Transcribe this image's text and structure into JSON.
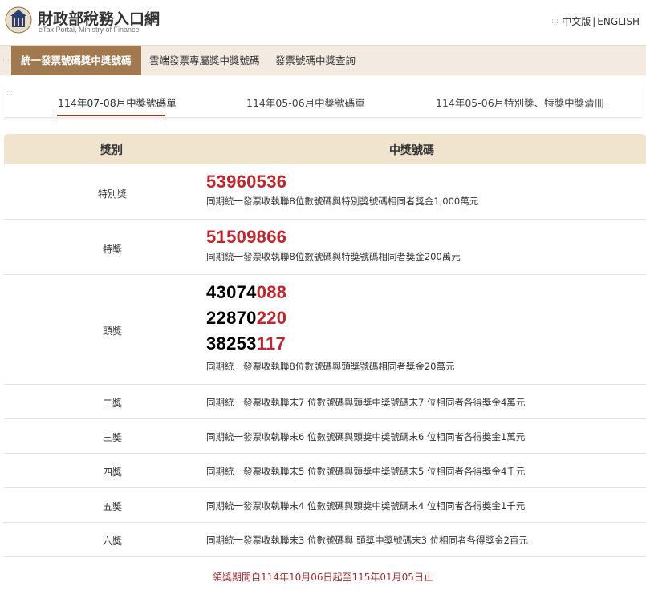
{
  "header": {
    "title": "財政部稅務入口網",
    "subtitle": "eTax Portal, Ministry of Finance",
    "lang_zh": "中文版",
    "lang_sep": "|",
    "lang_en": "ENGLISH"
  },
  "topnav": {
    "tabs": [
      {
        "label": "統一發票號碼獎中獎號碼",
        "active": true
      },
      {
        "label": "雲端發票專屬獎中獎號碼",
        "active": false
      },
      {
        "label": "發票號碼中獎查詢",
        "active": false
      }
    ]
  },
  "subnav": {
    "tabs": [
      {
        "label": "114年07-08月中獎號碼單",
        "active": true
      },
      {
        "label": "114年05-06月中獎號碼單",
        "active": false
      },
      {
        "label": "114年05-06月特別獎、特獎中獎清冊",
        "active": false
      }
    ]
  },
  "table": {
    "headers": [
      "獎別",
      "中獎號碼"
    ],
    "rows": [
      {
        "prize": "特別獎",
        "numbers": [
          {
            "black": "",
            "red": "53960536"
          }
        ],
        "desc": "同期統一發票收執聯8位數號碼與特別獎號碼相同者獎金1,000萬元"
      },
      {
        "prize": "特獎",
        "numbers": [
          {
            "black": "",
            "red": "51509866"
          }
        ],
        "desc": "同期統一發票收執聯8位數號碼與特獎號碼相同者獎金200萬元"
      },
      {
        "prize": "頭獎",
        "numbers": [
          {
            "black": "43074",
            "red": "088"
          },
          {
            "black": "22870",
            "red": "220"
          },
          {
            "black": "38253",
            "red": "117"
          }
        ],
        "desc": "同期統一發票收執聯8位數號碼與頭獎號碼相同者獎金20萬元"
      },
      {
        "prize": "二獎",
        "numbers": [],
        "desc": "同期統一發票收執聯末7 位數號碼與頭獎中獎號碼末7 位相同者各得獎金4萬元"
      },
      {
        "prize": "三獎",
        "numbers": [],
        "desc": "同期統一發票收執聯末6 位數號碼與頭獎中獎號碼末6 位相同者各得獎金1萬元"
      },
      {
        "prize": "四獎",
        "numbers": [],
        "desc": "同期統一發票收執聯末5 位數號碼與頭獎中獎號碼末5 位相同者各得獎金4千元"
      },
      {
        "prize": "五獎",
        "numbers": [],
        "desc": "同期統一發票收執聯末4 位數號碼與頭獎中獎號碼末4 位相同者各得獎金1千元"
      },
      {
        "prize": "六獎",
        "numbers": [],
        "desc": "同期統一發票收執聯末3 位數號碼與 頭獎中獎號碼末3 位相同者各得獎金2百元"
      }
    ]
  },
  "footer": "領獎期間自114年10月06日起至115年01月05日止",
  "colors": {
    "accent": "#a1794f",
    "winning_red": "#c0262d",
    "header_bg": "#f1e4cf"
  }
}
